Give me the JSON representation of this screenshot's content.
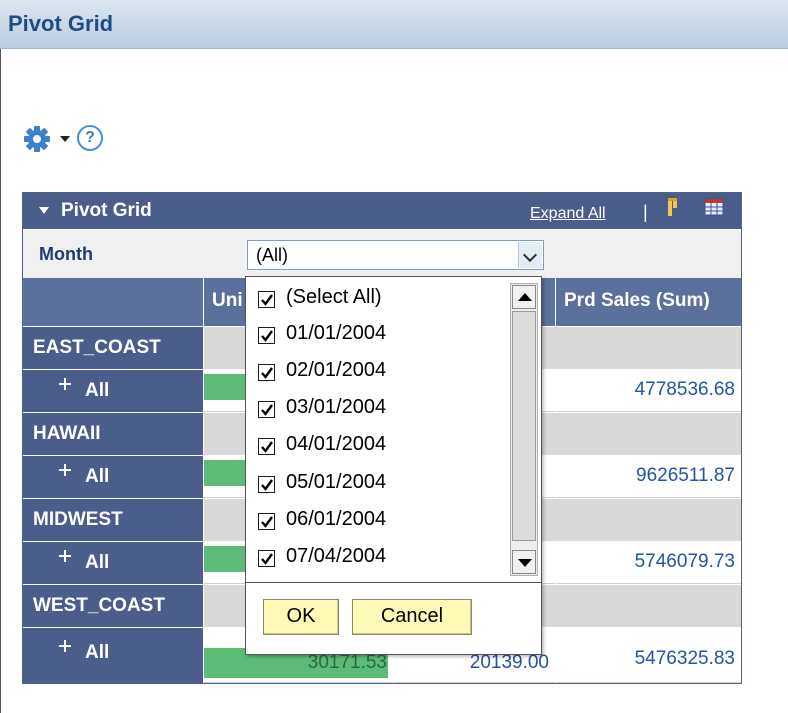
{
  "page": {
    "title": "Pivot Grid"
  },
  "toolbar": {
    "gear_icon": "gear-icon",
    "menu_caret": "chevron-down-icon",
    "help_label": "?"
  },
  "grid": {
    "title": "Pivot Grid",
    "expand_all": "Expand All",
    "separator": "|",
    "filter": {
      "label": "Month",
      "value": "(All)"
    },
    "columns": [
      "Uni",
      "Prd Sales (Sum)"
    ],
    "rows": [
      {
        "region": "EAST_COAST",
        "child": "All",
        "sales": "4778536.68",
        "units_fraction": 0.45
      },
      {
        "region": "HAWAII",
        "child": "All",
        "sales": "9626511.87",
        "units_fraction": 0.45
      },
      {
        "region": "MIDWEST",
        "child": "All",
        "sales": "5746079.73",
        "units_fraction": 0.45
      },
      {
        "region": "WEST_COAST",
        "child": "All",
        "sales": "5476325.83",
        "units_fraction": 0.95,
        "units_partial": "30171.53",
        "mid_partial": "20139.00"
      }
    ]
  },
  "month_dropdown": {
    "options": [
      {
        "label": "(Select All)",
        "checked": true
      },
      {
        "label": "01/01/2004",
        "checked": true
      },
      {
        "label": "02/01/2004",
        "checked": true
      },
      {
        "label": "03/01/2004",
        "checked": true
      },
      {
        "label": "04/01/2004",
        "checked": true
      },
      {
        "label": "05/01/2004",
        "checked": true
      },
      {
        "label": "06/01/2004",
        "checked": true
      },
      {
        "label": "07/04/2004",
        "checked": true
      }
    ],
    "ok_label": "OK",
    "cancel_label": "Cancel"
  },
  "colors": {
    "header_blue": "#4b5d8a",
    "accent_bar": "#5cbc77",
    "value_text": "#2255a4",
    "button_yellow": "#fffbb7"
  }
}
